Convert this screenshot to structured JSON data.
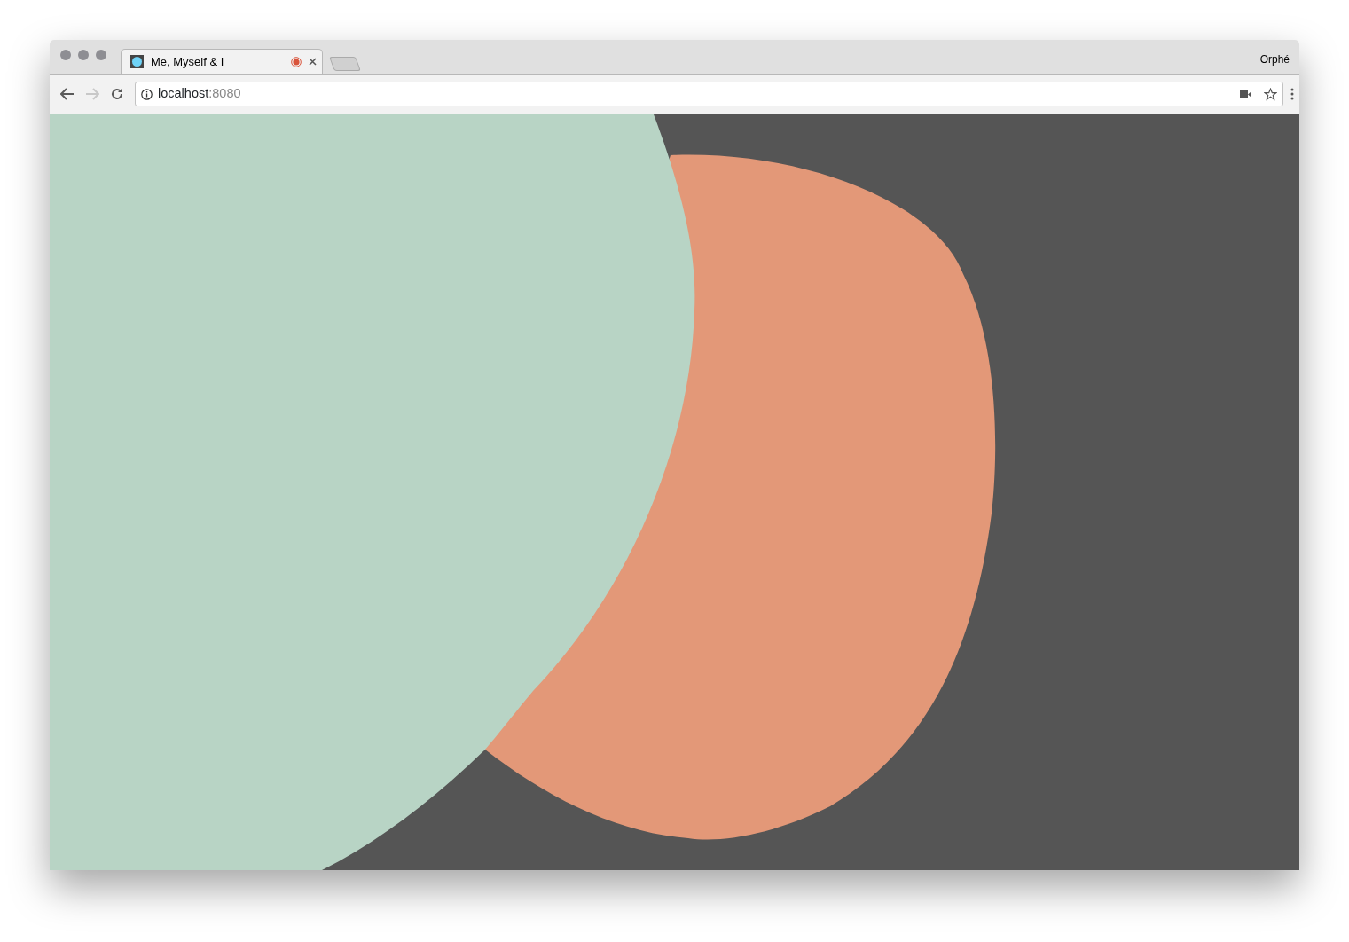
{
  "tabs": [
    {
      "title": "Me, Myself & I",
      "selected": true,
      "recording": true
    }
  ],
  "profile": "Orphé",
  "toolbar": {
    "back_disabled": false,
    "forward_disabled": true
  },
  "address": {
    "host": "localhost",
    "port": ":8080"
  }
}
